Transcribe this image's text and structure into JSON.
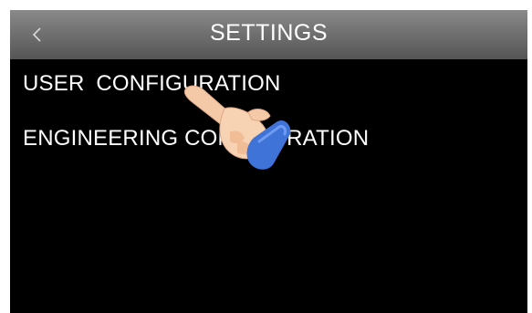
{
  "header": {
    "title": "SETTINGS",
    "back_icon": "chevron-left-icon"
  },
  "menu": {
    "items": [
      {
        "label": "USER CONFIGURATION"
      },
      {
        "label": "ENGINEERING CONFIGURATION"
      }
    ]
  },
  "overlay": {
    "icon": "pointing-hand-icon"
  },
  "colors": {
    "screen_background": "#000000",
    "title_bar": "#6f6f6f",
    "text": "#ffffff",
    "cuff": "#3f73d8"
  }
}
